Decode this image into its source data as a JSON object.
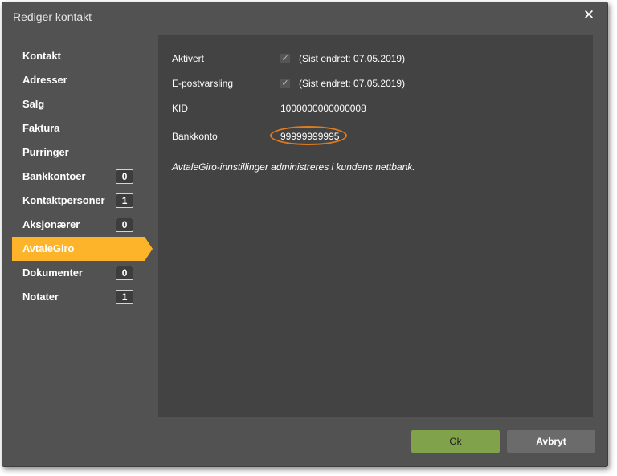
{
  "dialog": {
    "title": "Rediger kontakt",
    "close_symbol": "✕"
  },
  "sidebar": {
    "items": [
      {
        "label": "Kontakt",
        "badge": null
      },
      {
        "label": "Adresser",
        "badge": null
      },
      {
        "label": "Salg",
        "badge": null
      },
      {
        "label": "Faktura",
        "badge": null
      },
      {
        "label": "Purringer",
        "badge": null
      },
      {
        "label": "Bankkontoer",
        "badge": "0"
      },
      {
        "label": "Kontaktpersoner",
        "badge": "1"
      },
      {
        "label": "Aksjonærer",
        "badge": "0"
      },
      {
        "label": "AvtaleGiro",
        "badge": null,
        "active": true
      },
      {
        "label": "Dokumenter",
        "badge": "0"
      },
      {
        "label": "Notater",
        "badge": "1"
      }
    ]
  },
  "panel": {
    "activated": {
      "label": "Aktivert",
      "checked": true,
      "changed": "(Sist endret: 07.05.2019)"
    },
    "email_notify": {
      "label": "E-postvarsling",
      "checked": true,
      "changed": "(Sist endret: 07.05.2019)"
    },
    "kid": {
      "label": "KID",
      "value": "1000000000000008"
    },
    "bank_account": {
      "label": "Bankkonto",
      "value": "99999999995"
    },
    "note": "AvtaleGiro-innstillinger administreres i kundens nettbank."
  },
  "buttons": {
    "ok": "Ok",
    "cancel": "Avbryt"
  },
  "colors": {
    "accent": "#fdb42a",
    "ok": "#80a24a",
    "highlight": "#e07b1e"
  }
}
